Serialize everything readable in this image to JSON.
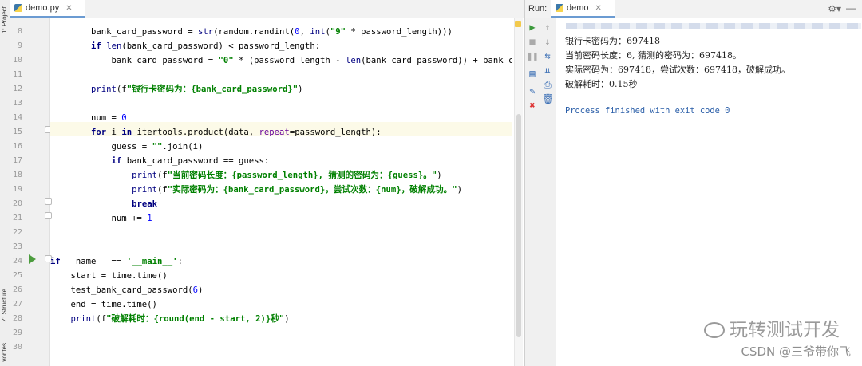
{
  "left_strip": {
    "project_tab": "1: Project",
    "structure_tab": "Z: Structure",
    "favorites_tab": "vorites"
  },
  "editor": {
    "file_tab": "demo.py",
    "lines": [
      {
        "n": "8",
        "code": "        bank_card_password = str(random.randint(0, int(\"9\" * password_length)))"
      },
      {
        "n": "9",
        "code": "        if len(bank_card_password) < password_length:"
      },
      {
        "n": "10",
        "code": "            bank_card_password = \"0\" * (password_length - len(bank_card_password)) + bank_card_password"
      },
      {
        "n": "11",
        "code": ""
      },
      {
        "n": "12",
        "code": "        print(f\"银行卡密码为：{bank_card_password}\")"
      },
      {
        "n": "13",
        "code": ""
      },
      {
        "n": "14",
        "code": "        num = 0"
      },
      {
        "n": "15",
        "code": "        for i in itertools.product(data, repeat=password_length):"
      },
      {
        "n": "16",
        "code": "            guess = \"\".join(i)"
      },
      {
        "n": "17",
        "code": "            if bank_card_password == guess:"
      },
      {
        "n": "18",
        "code": "                print(f\"当前密码长度：{password_length}, 猜测的密码为：{guess}。\")"
      },
      {
        "n": "19",
        "code": "                print(f\"实际密码为：{bank_card_password}，尝试次数：{num}，破解成功。\")"
      },
      {
        "n": "20",
        "code": "                break"
      },
      {
        "n": "21",
        "code": "            num += 1"
      },
      {
        "n": "22",
        "code": ""
      },
      {
        "n": "23",
        "code": ""
      },
      {
        "n": "24",
        "code": "if __name__ == '__main__':"
      },
      {
        "n": "25",
        "code": "    start = time.time()"
      },
      {
        "n": "26",
        "code": "    test_bank_card_password(6)"
      },
      {
        "n": "27",
        "code": "    end = time.time()"
      },
      {
        "n": "28",
        "code": "    print(f\"破解耗时：{round(end - start, 2)}秒\")"
      },
      {
        "n": "29",
        "code": ""
      },
      {
        "n": "30",
        "code": ""
      }
    ]
  },
  "run_panel": {
    "label": "Run:",
    "tab": "demo",
    "output": [
      "银行卡密码为：697418",
      "当前密码长度：6, 猜测的密码为：697418。",
      "实际密码为：697418，尝试次数：697418，破解成功。",
      "破解耗时：0.15秒"
    ],
    "exit_message": "Process finished with exit code 0"
  },
  "watermark": {
    "title": "玩转测试开发",
    "author": "CSDN @三爷带你飞"
  }
}
